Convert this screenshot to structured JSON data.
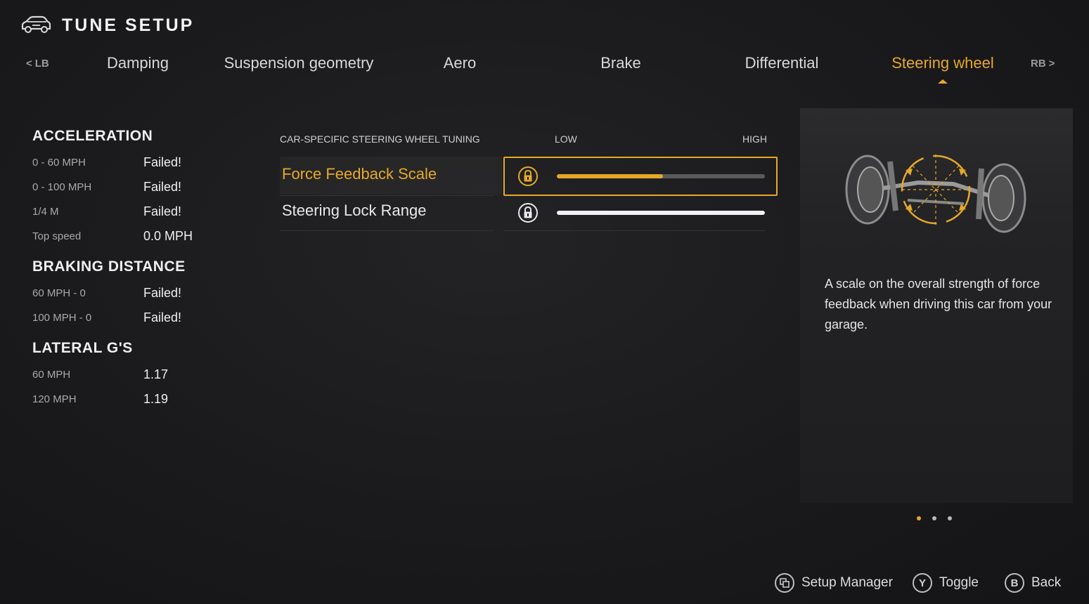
{
  "header": {
    "title": "TUNE SETUP",
    "icon": "car-icon"
  },
  "tabs": {
    "left_bumper": "LB",
    "right_bumper": "RB",
    "items": [
      {
        "label": "Damping"
      },
      {
        "label": "Suspension geometry"
      },
      {
        "label": "Aero"
      },
      {
        "label": "Brake"
      },
      {
        "label": "Differential"
      },
      {
        "label": "Steering wheel"
      }
    ],
    "active": "Steering wheel"
  },
  "stats": {
    "acceleration": {
      "heading": "ACCELERATION",
      "rows": [
        {
          "label": "0 - 60 MPH",
          "value": "Failed!"
        },
        {
          "label": "0 - 100 MPH",
          "value": "Failed!"
        },
        {
          "label": "1/4 M",
          "value": "Failed!"
        },
        {
          "label": "Top speed",
          "value": "0.0 MPH"
        }
      ]
    },
    "braking": {
      "heading": "BRAKING DISTANCE",
      "rows": [
        {
          "label": "60 MPH - 0",
          "value": "Failed!"
        },
        {
          "label": "100 MPH - 0",
          "value": "Failed!"
        }
      ]
    },
    "lateral": {
      "heading": "LATERAL G'S",
      "rows": [
        {
          "label": "60 MPH",
          "value": "1.17"
        },
        {
          "label": "120 MPH",
          "value": "1.19"
        }
      ]
    }
  },
  "tuning": {
    "section_label": "CAR-SPECIFIC STEERING WHEEL TUNING",
    "low_label": "LOW",
    "high_label": "HIGH",
    "settings": [
      {
        "label": "Force Feedback Scale",
        "locked": true,
        "level": 0.51,
        "selected": true
      },
      {
        "label": "Steering Lock Range",
        "locked": true,
        "level": 1.0,
        "selected": false
      }
    ]
  },
  "info": {
    "description": "A scale on the overall strength of force feedback when driving this car from your garage.",
    "page_count": 3,
    "current_page": 1
  },
  "footer": {
    "setup_manager": "Setup Manager",
    "toggle_key": "Y",
    "toggle": "Toggle",
    "back_key": "B",
    "back": "Back"
  },
  "colors": {
    "accent": "#e6a82a",
    "background": "#1a1a1c",
    "track": "#5a5a5a"
  }
}
